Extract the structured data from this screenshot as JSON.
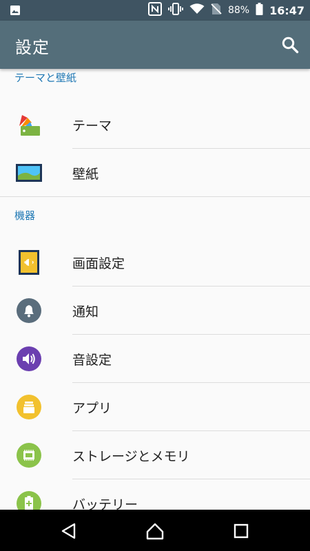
{
  "status_bar": {
    "battery_percent": "88%",
    "time": "16:47",
    "icons": [
      "image-icon",
      "nfc-icon",
      "vibrate-icon",
      "wifi-icon",
      "no-sim-icon",
      "battery-icon"
    ]
  },
  "app_bar": {
    "title": "設定",
    "search_icon": "search-icon"
  },
  "sections": [
    {
      "header": "テーマと壁紙",
      "items": [
        {
          "label": "テーマ",
          "icon": "theme-icon"
        },
        {
          "label": "壁紙",
          "icon": "wallpaper-icon"
        }
      ]
    },
    {
      "header": "機器",
      "items": [
        {
          "label": "画面設定",
          "icon": "display-icon",
          "color": "#f2c12e"
        },
        {
          "label": "通知",
          "icon": "bell-icon",
          "color": "#5a6d7c"
        },
        {
          "label": "音設定",
          "icon": "volume-icon",
          "color": "#6b3fb0"
        },
        {
          "label": "アプリ",
          "icon": "apps-icon",
          "color": "#f2c12e"
        },
        {
          "label": "ストレージとメモリ",
          "icon": "storage-icon",
          "color": "#8bc34a"
        },
        {
          "label": "バッテリー",
          "icon": "battery-icon",
          "color": "#8bc34a"
        }
      ]
    }
  ],
  "colors": {
    "status_bar": "#3f5462",
    "app_bar": "#546e7a",
    "section_header": "#1f78b4",
    "background": "#fafafa"
  },
  "nav_bar": {
    "icons": [
      "back-icon",
      "home-icon",
      "recents-icon"
    ]
  }
}
